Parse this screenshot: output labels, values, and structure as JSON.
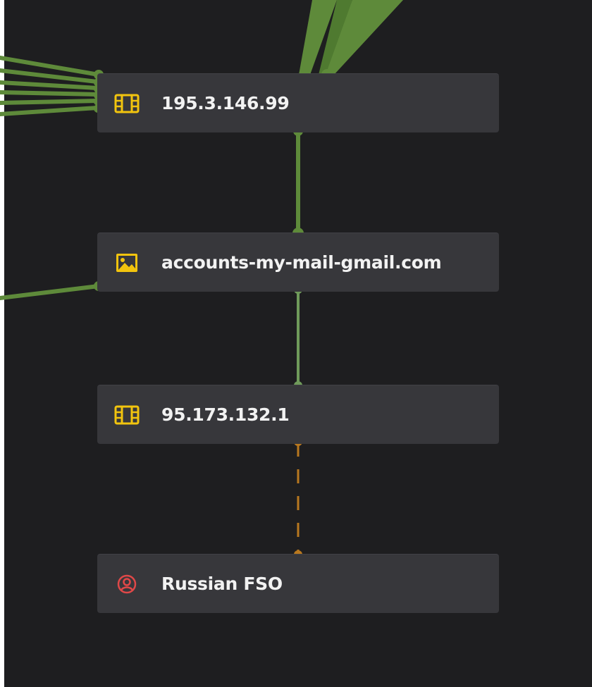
{
  "colors": {
    "background": "#1e1e20",
    "node_fill": "#37373b",
    "edge_green": "#5e8a3a",
    "edge_green_light": "#6f9a5a",
    "edge_orange": "#b8781f",
    "icon_yellow": "#f2c40e",
    "icon_red": "#e04848",
    "label_text": "#f2f2f2"
  },
  "nodes": [
    {
      "id": "n1",
      "label": "195.3.146.99",
      "icon": "film-icon"
    },
    {
      "id": "n2",
      "label": "accounts-my-mail-gmail.com",
      "icon": "image-icon"
    },
    {
      "id": "n3",
      "label": "95.173.132.1",
      "icon": "film-icon"
    },
    {
      "id": "n4",
      "label": "Russian FSO",
      "icon": "person-circle-icon"
    }
  ],
  "edges": [
    {
      "from": "n1",
      "to": "n2",
      "style": "solid-green"
    },
    {
      "from": "n2",
      "to": "n3",
      "style": "solid-green-thin"
    },
    {
      "from": "n3",
      "to": "n4",
      "style": "dashed-orange"
    }
  ]
}
